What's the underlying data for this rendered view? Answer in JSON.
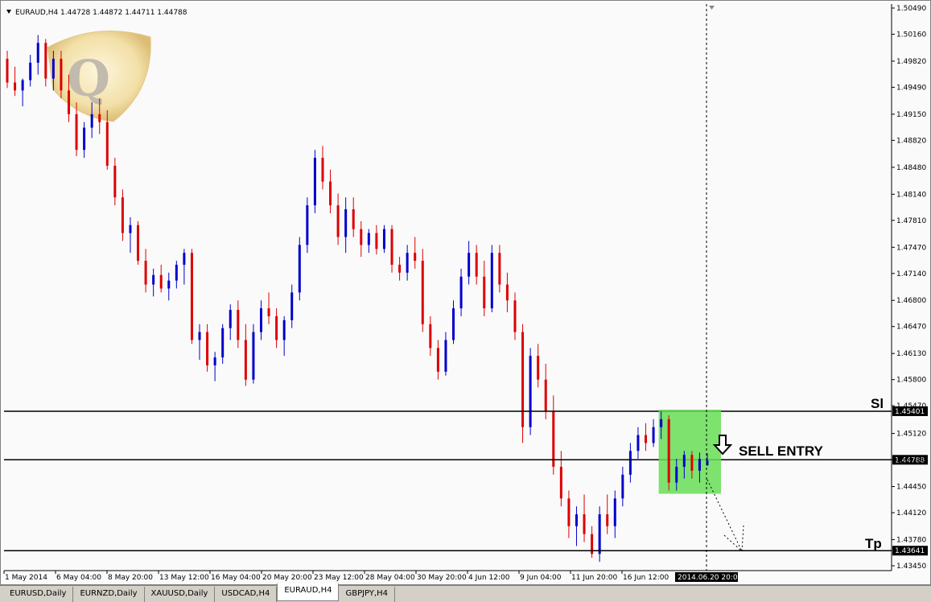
{
  "window": {
    "title": "EURAUD,H4  1.44728 1.44872 1.44711 1.44788",
    "arrow_icon": "triangle-down-icon"
  },
  "chart_data": {
    "type": "candlestick",
    "symbol": "EURAUD",
    "timeframe": "H4",
    "ohlc_header": {
      "open": 1.44728,
      "high": 1.44872,
      "low": 1.44711,
      "close": 1.44788
    },
    "ylim": [
      1.4345,
      1.5049
    ],
    "y_ticks": [
      "1.50490",
      "1.50160",
      "1.49820",
      "1.49490",
      "1.49150",
      "1.48820",
      "1.48480",
      "1.48140",
      "1.47810",
      "1.47470",
      "1.47140",
      "1.46800",
      "1.46470",
      "1.46130",
      "1.45800",
      "1.45470",
      "1.45120",
      "1.44790",
      "1.44450",
      "1.44120",
      "1.43780",
      "1.43450"
    ],
    "x_ticks": [
      "1 May 2014",
      "6 May 04:00",
      "8 May 20:00",
      "13 May 12:00",
      "16 May 04:00",
      "20 May 20:00",
      "23 May 12:00",
      "28 May 04:00",
      "30 May 20:00",
      "4 Jun 12:00",
      "9 Jun 04:00",
      "11 Jun 20:00",
      "16 Jun 12:00"
    ],
    "cursor_time_label": "2014.06.20 20:00",
    "bull_color": "#0000cc",
    "bear_color": "#dd0000",
    "candles": [
      [
        1.4985,
        1.4995,
        1.4948,
        1.4955
      ],
      [
        1.4955,
        1.4975,
        1.4938,
        1.4945
      ],
      [
        1.4945,
        1.496,
        1.4925,
        1.4958
      ],
      [
        1.4958,
        1.499,
        1.495,
        1.498
      ],
      [
        1.498,
        1.5015,
        1.4965,
        1.5005
      ],
      [
        1.5005,
        1.501,
        1.495,
        1.496
      ],
      [
        1.496,
        1.4995,
        1.4945,
        1.4985
      ],
      [
        1.4985,
        1.4995,
        1.4935,
        1.4945
      ],
      [
        1.4945,
        1.4965,
        1.4905,
        1.4915
      ],
      [
        1.4915,
        1.493,
        1.4862,
        1.487
      ],
      [
        1.487,
        1.4905,
        1.486,
        1.4898
      ],
      [
        1.4898,
        1.493,
        1.4885,
        1.4915
      ],
      [
        1.4915,
        1.4935,
        1.489,
        1.4905
      ],
      [
        1.4905,
        1.492,
        1.4845,
        1.485
      ],
      [
        1.485,
        1.486,
        1.48,
        1.481
      ],
      [
        1.481,
        1.482,
        1.4755,
        1.4765
      ],
      [
        1.4765,
        1.4785,
        1.474,
        1.4775
      ],
      [
        1.4775,
        1.478,
        1.4725,
        1.473
      ],
      [
        1.473,
        1.4745,
        1.469,
        1.47
      ],
      [
        1.47,
        1.472,
        1.4685,
        1.4712
      ],
      [
        1.4712,
        1.4725,
        1.469,
        1.4695
      ],
      [
        1.4695,
        1.4715,
        1.468,
        1.4705
      ],
      [
        1.4705,
        1.473,
        1.4695,
        1.4725
      ],
      [
        1.4725,
        1.4745,
        1.47,
        1.474
      ],
      [
        1.474,
        1.4745,
        1.4625,
        1.463
      ],
      [
        1.463,
        1.465,
        1.4605,
        1.464
      ],
      [
        1.464,
        1.465,
        1.459,
        1.4598
      ],
      [
        1.4598,
        1.4615,
        1.4578,
        1.4608
      ],
      [
        1.4608,
        1.465,
        1.46,
        1.4645
      ],
      [
        1.4645,
        1.4675,
        1.463,
        1.4668
      ],
      [
        1.4668,
        1.468,
        1.462,
        1.463
      ],
      [
        1.463,
        1.465,
        1.4572,
        1.458
      ],
      [
        1.458,
        1.465,
        1.4575,
        1.464
      ],
      [
        1.464,
        1.468,
        1.463,
        1.467
      ],
      [
        1.467,
        1.469,
        1.465,
        1.466
      ],
      [
        1.466,
        1.467,
        1.462,
        1.463
      ],
      [
        1.463,
        1.466,
        1.461,
        1.4655
      ],
      [
        1.4655,
        1.47,
        1.4645,
        1.469
      ],
      [
        1.469,
        1.476,
        1.468,
        1.475
      ],
      [
        1.475,
        1.481,
        1.474,
        1.48
      ],
      [
        1.48,
        1.487,
        1.479,
        1.486
      ],
      [
        1.486,
        1.4875,
        1.482,
        1.483
      ],
      [
        1.483,
        1.4845,
        1.479,
        1.48
      ],
      [
        1.48,
        1.4815,
        1.475,
        1.476
      ],
      [
        1.476,
        1.481,
        1.474,
        1.4795
      ],
      [
        1.4795,
        1.481,
        1.476,
        1.477
      ],
      [
        1.477,
        1.478,
        1.4735,
        1.475
      ],
      [
        1.475,
        1.477,
        1.474,
        1.4765
      ],
      [
        1.4765,
        1.4775,
        1.4738,
        1.4745
      ],
      [
        1.4745,
        1.4775,
        1.474,
        1.477
      ],
      [
        1.477,
        1.4775,
        1.4715,
        1.4725
      ],
      [
        1.4725,
        1.4735,
        1.4705,
        1.4715
      ],
      [
        1.4715,
        1.475,
        1.4705,
        1.474
      ],
      [
        1.474,
        1.476,
        1.472,
        1.473
      ],
      [
        1.473,
        1.4745,
        1.464,
        1.465
      ],
      [
        1.465,
        1.466,
        1.461,
        1.462
      ],
      [
        1.462,
        1.463,
        1.458,
        1.459
      ],
      [
        1.459,
        1.464,
        1.4585,
        1.463
      ],
      [
        1.463,
        1.468,
        1.4625,
        1.467
      ],
      [
        1.467,
        1.472,
        1.466,
        1.471
      ],
      [
        1.471,
        1.4755,
        1.47,
        1.474
      ],
      [
        1.474,
        1.475,
        1.47,
        1.471
      ],
      [
        1.471,
        1.473,
        1.466,
        1.467
      ],
      [
        1.467,
        1.475,
        1.4665,
        1.474
      ],
      [
        1.474,
        1.475,
        1.469,
        1.47
      ],
      [
        1.47,
        1.4715,
        1.4665,
        1.468
      ],
      [
        1.468,
        1.469,
        1.463,
        1.464
      ],
      [
        1.464,
        1.465,
        1.45,
        1.452
      ],
      [
        1.452,
        1.462,
        1.451,
        1.461
      ],
      [
        1.461,
        1.4625,
        1.457,
        1.458
      ],
      [
        1.458,
        1.46,
        1.453,
        1.454
      ],
      [
        1.454,
        1.456,
        1.446,
        1.447
      ],
      [
        1.447,
        1.449,
        1.442,
        1.443
      ],
      [
        1.443,
        1.444,
        1.438,
        1.4395
      ],
      [
        1.4395,
        1.442,
        1.437,
        1.441
      ],
      [
        1.441,
        1.4435,
        1.4375,
        1.4385
      ],
      [
        1.4385,
        1.4395,
        1.4355,
        1.436
      ],
      [
        1.436,
        1.442,
        1.435,
        1.441
      ],
      [
        1.441,
        1.4435,
        1.4385,
        1.4395
      ],
      [
        1.4395,
        1.444,
        1.438,
        1.443
      ],
      [
        1.443,
        1.447,
        1.442,
        1.446
      ],
      [
        1.446,
        1.45,
        1.445,
        1.449
      ],
      [
        1.449,
        1.452,
        1.448,
        1.451
      ],
      [
        1.451,
        1.4525,
        1.449,
        1.45
      ],
      [
        1.45,
        1.453,
        1.4495,
        1.452
      ],
      [
        1.452,
        1.454,
        1.4505,
        1.453
      ],
      [
        1.453,
        1.4535,
        1.444,
        1.445
      ],
      [
        1.445,
        1.448,
        1.444,
        1.447
      ],
      [
        1.447,
        1.449,
        1.4455,
        1.4485
      ],
      [
        1.4485,
        1.449,
        1.4455,
        1.4465
      ],
      [
        1.4465,
        1.4488,
        1.445,
        1.448
      ],
      [
        1.4472,
        1.4487,
        1.4471,
        1.4478
      ]
    ],
    "levels": [
      {
        "name": "Sl",
        "price": 1.45401,
        "label": "1.45401"
      },
      {
        "name": "entry",
        "price": 1.44788,
        "label": "1.44788"
      },
      {
        "name": "Tp",
        "price": 1.43641,
        "label": "1.43641"
      }
    ],
    "annotations": {
      "sell_entry_text": "SELL ENTRY",
      "sl_text": "Sl",
      "tp_text": "Tp",
      "sell_arrow_icon": "arrow-down-icon",
      "entry_zone_color": "#66dd55"
    }
  },
  "logo": {
    "icon": "q-logo-icon",
    "text": "Q"
  },
  "tabs": [
    {
      "label": "EURUSD,Daily",
      "active": false
    },
    {
      "label": "EURNZD,Daily",
      "active": false
    },
    {
      "label": "XAUUSD,Daily",
      "active": false
    },
    {
      "label": "USDCAD,H4",
      "active": false
    },
    {
      "label": "EURAUD,H4",
      "active": true
    },
    {
      "label": "GBPJPY,H4",
      "active": false
    }
  ]
}
